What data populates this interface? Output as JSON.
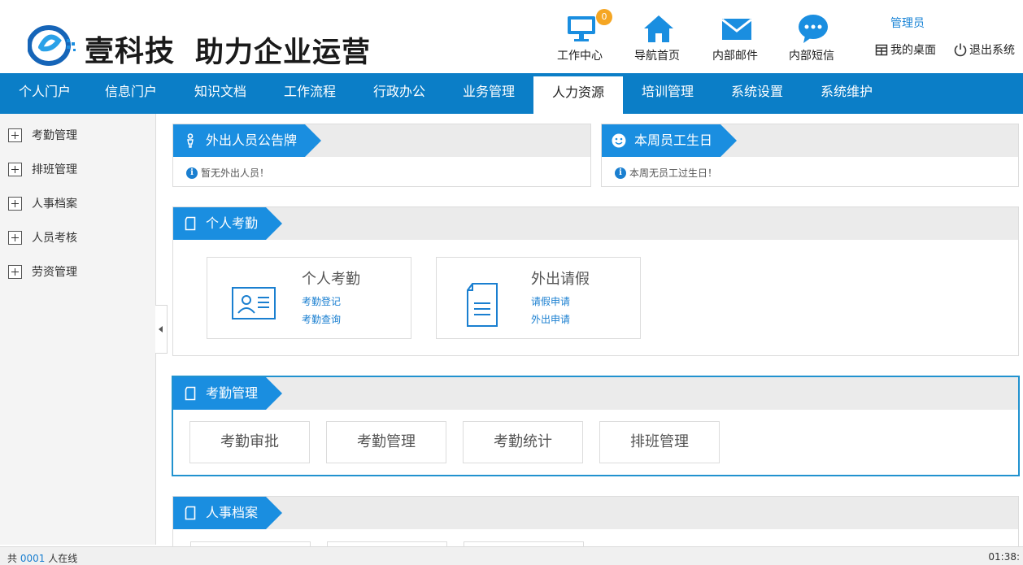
{
  "brand": {
    "name": "壹科技",
    "slogan": "助力企业运营"
  },
  "header": {
    "buttons": [
      {
        "label": "工作中心",
        "icon": "monitor-icon",
        "badge": "0"
      },
      {
        "label": "导航首页",
        "icon": "home-icon"
      },
      {
        "label": "内部邮件",
        "icon": "mail-icon"
      },
      {
        "label": "内部短信",
        "icon": "chat-icon"
      }
    ],
    "user": "管理员",
    "desk": "我的桌面",
    "logout": "退出系统"
  },
  "nav": {
    "items": [
      "个人门户",
      "信息门户",
      "知识文档",
      "工作流程",
      "行政办公",
      "业务管理",
      "人力资源",
      "培训管理",
      "系统设置",
      "系统维护"
    ],
    "active": "人力资源"
  },
  "sidebar": {
    "items": [
      "考勤管理",
      "排班管理",
      "人事档案",
      "人员考核",
      "劳资管理"
    ]
  },
  "panels": {
    "outgoing": {
      "title": "外出人员公告牌",
      "info": "暂无外出人员！"
    },
    "birthday": {
      "title": "本周员工生日",
      "info": "本周无员工过生日！"
    },
    "personal": {
      "title": "个人考勤",
      "cards": [
        {
          "title": "个人考勤",
          "links": [
            "考勤登记",
            "考勤查询"
          ]
        },
        {
          "title": "外出请假",
          "links": [
            "请假申请",
            "外出申请"
          ]
        }
      ]
    },
    "attendance": {
      "title": "考勤管理",
      "buttons": [
        "考勤审批",
        "考勤管理",
        "考勤统计",
        "排班管理"
      ]
    },
    "hr": {
      "title": "人事档案"
    }
  },
  "status": {
    "prefix": "共",
    "count": "0001",
    "suffix": "人在线",
    "time": "01:38:"
  },
  "colors": {
    "primary": "#0b7ec7",
    "accent": "#1a8ee0",
    "badge": "#f5a623"
  }
}
